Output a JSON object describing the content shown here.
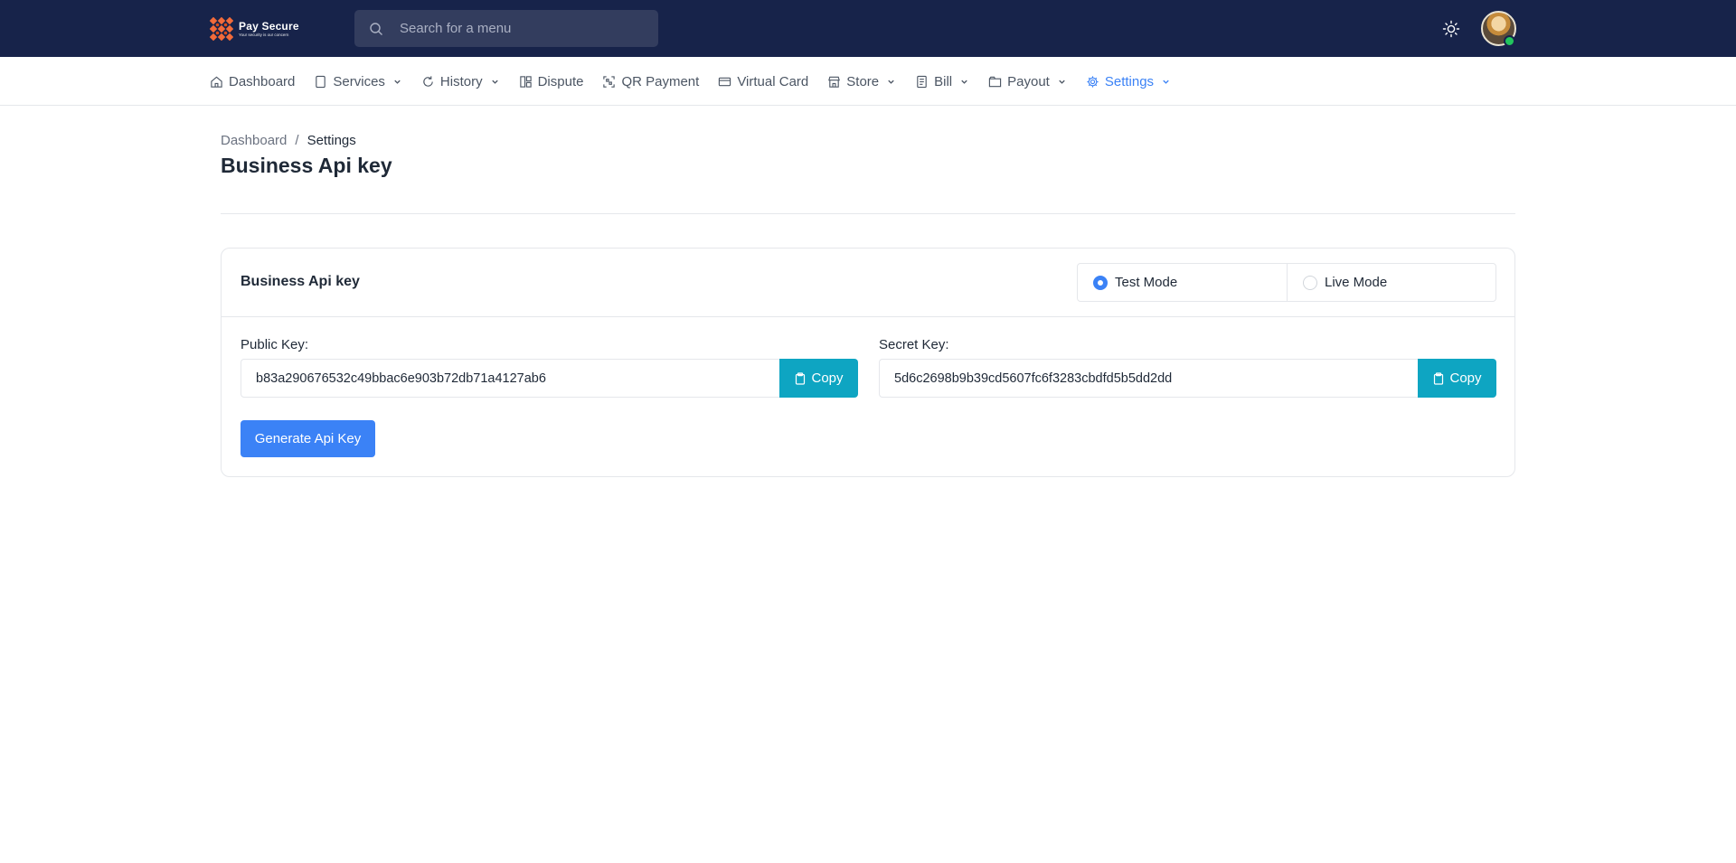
{
  "header": {
    "logo": {
      "name": "Pay Secure",
      "tagline": "Your security is our concern",
      "brand_color": "#f26b3a"
    },
    "search": {
      "placeholder": "Search for a menu"
    },
    "theme_icon": "sun-icon",
    "bg_color": "#17234a"
  },
  "nav": {
    "items": [
      {
        "label": "Dashboard",
        "icon": "home-icon",
        "has_dropdown": false
      },
      {
        "label": "Services",
        "icon": "page-icon",
        "has_dropdown": true
      },
      {
        "label": "History",
        "icon": "refresh-icon",
        "has_dropdown": true
      },
      {
        "label": "Dispute",
        "icon": "layout-icon",
        "has_dropdown": false
      },
      {
        "label": "QR Payment",
        "icon": "qr-icon",
        "has_dropdown": false
      },
      {
        "label": "Virtual Card",
        "icon": "card-icon",
        "has_dropdown": false
      },
      {
        "label": "Store",
        "icon": "store-icon",
        "has_dropdown": true
      },
      {
        "label": "Bill",
        "icon": "receipt-icon",
        "has_dropdown": true
      },
      {
        "label": "Payout",
        "icon": "wallet-icon",
        "has_dropdown": true
      },
      {
        "label": "Settings",
        "icon": "gear-icon",
        "has_dropdown": true,
        "active": true
      }
    ],
    "active_color": "#3b82f6"
  },
  "breadcrumb": {
    "parent": "Dashboard",
    "separator": "/",
    "current": "Settings"
  },
  "page_title": "Business Api key",
  "card": {
    "title": "Business Api key",
    "modes": [
      {
        "label": "Test Mode",
        "checked": true
      },
      {
        "label": "Live Mode",
        "checked": false
      }
    ],
    "public_key": {
      "label": "Public Key:",
      "value": "b83a290676532c49bbac6e903b72db71a4127ab6",
      "copy_label": "Copy"
    },
    "secret_key": {
      "label": "Secret Key:",
      "value": "5d6c2698b9b39cd5607fc6f3283cbdfd5b5dd2dd",
      "copy_label": "Copy"
    },
    "generate_label": "Generate Api Key",
    "copy_color": "#0ea5c2",
    "primary_color": "#3b82f6"
  }
}
